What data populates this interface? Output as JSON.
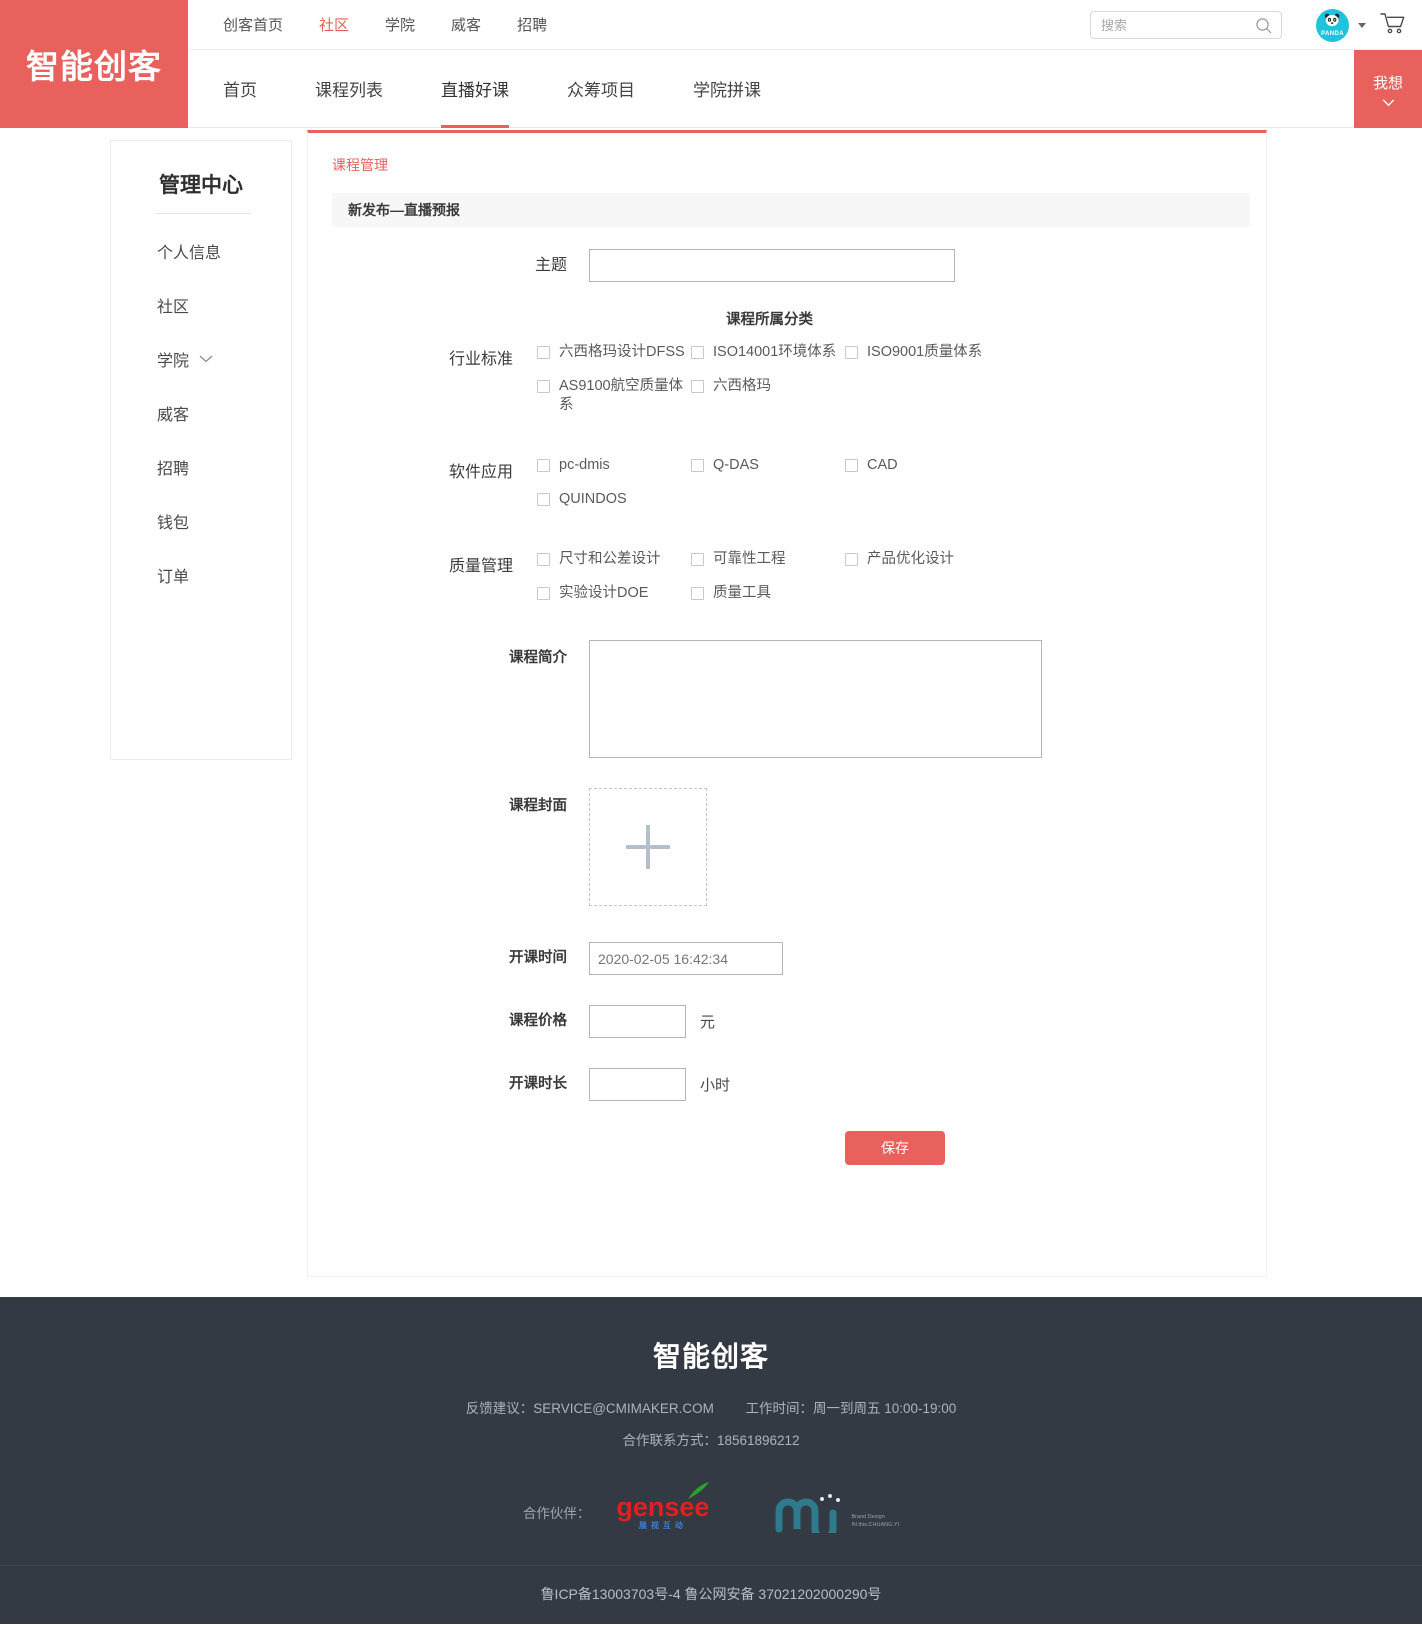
{
  "brand": {
    "logo": "智能创客"
  },
  "topnav": {
    "items": [
      {
        "label": "创客首页",
        "active": false
      },
      {
        "label": "社区",
        "active": true
      },
      {
        "label": "学院",
        "active": false
      },
      {
        "label": "威客",
        "active": false
      },
      {
        "label": "招聘",
        "active": false
      }
    ]
  },
  "search": {
    "placeholder": "搜索",
    "value": ""
  },
  "user": {
    "avatar_label": "PANDA",
    "avatar_color": "#1ec3dd"
  },
  "mainnav": {
    "tabs": [
      {
        "label": "首页",
        "active": false
      },
      {
        "label": "课程列表",
        "active": false
      },
      {
        "label": "直播好课",
        "active": true
      },
      {
        "label": "众筹项目",
        "active": false
      },
      {
        "label": "学院拼课",
        "active": false
      }
    ],
    "action": {
      "label": "我想"
    }
  },
  "sidebar": {
    "title": "管理中心",
    "items": [
      {
        "label": "个人信息",
        "expandable": false
      },
      {
        "label": "社区",
        "expandable": false
      },
      {
        "label": "学院",
        "expandable": true
      },
      {
        "label": "威客",
        "expandable": false
      },
      {
        "label": "招聘",
        "expandable": false
      },
      {
        "label": "钱包",
        "expandable": false
      },
      {
        "label": "订单",
        "expandable": false
      }
    ]
  },
  "content": {
    "breadcrumb": "课程管理",
    "section_title": "新发布—直播预报",
    "fields": {
      "subject_label": "主题",
      "subject_value": "",
      "category_title": "课程所属分类",
      "intro_label": "课程简介",
      "intro_value": "",
      "cover_label": "课程封面",
      "start_time_label": "开课时间",
      "start_time_value": "2020-02-05 16:42:34",
      "price_label": "课程价格",
      "price_value": "",
      "price_unit": "元",
      "duration_label": "开课时长",
      "duration_value": "",
      "duration_unit": "小时"
    },
    "categories": [
      {
        "name": "行业标准",
        "options": [
          "六西格玛设计DFSS",
          "ISO14001环境体系",
          "ISO9001质量体系",
          "AS9100航空质量体系",
          "六西格玛"
        ]
      },
      {
        "name": "软件应用",
        "options": [
          "pc-dmis",
          "Q-DAS",
          "CAD",
          "QUINDOS"
        ]
      },
      {
        "name": "质量管理",
        "options": [
          "尺寸和公差设计",
          "可靠性工程",
          "产品优化设计",
          "实验设计DOE",
          "质量工具"
        ]
      }
    ],
    "save_label": "保存"
  },
  "footer": {
    "title": "智能创客",
    "feedback": "反馈建议：SERVICE@CMIMAKER.COM",
    "hours": "工作时间：周一到周五 10:00-19:00",
    "contact": "合作联系方式：18561896212",
    "partner_label": "合作伙伴：",
    "partner1": "gensee",
    "partner1_sub": "展视互动",
    "partner2_sub": "Brand Design\nIN.this.CHUANG.YI",
    "icp": "鲁ICP备13003703号-4 鲁公网安备 37021202000290号"
  },
  "colors": {
    "accent": "#e8615c",
    "footer_bg": "#343a44",
    "avatar": "#1ec3dd"
  }
}
